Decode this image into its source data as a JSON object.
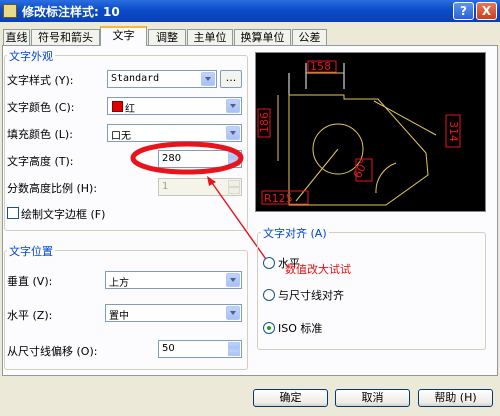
{
  "window": {
    "title": "修改标注样式: 10",
    "help": "?",
    "close": "X"
  },
  "tabs": [
    "直线",
    "符号和箭头",
    "文字",
    "调整",
    "主单位",
    "换算单位",
    "公差"
  ],
  "text_appearance": {
    "group": "文字外观",
    "style_label": "文字样式 (Y):",
    "style_value": "Standard",
    "style_button": "...",
    "color_label": "文字颜色 (C):",
    "color_value": "红",
    "color_swatch": "#e00000",
    "fill_label": "填充颜色 (L):",
    "fill_value": "口无",
    "height_label": "文字高度 (T):",
    "height_value": "280",
    "fraction_label": "分数高度比例 (H):",
    "fraction_value": "1",
    "frame_label": "绘制文字边框 (F)"
  },
  "text_position": {
    "group": "文字位置",
    "vertical_label": "垂直 (V):",
    "vertical_value": "上方",
    "horizontal_label": "水平 (Z):",
    "horizontal_value": "置中",
    "offset_label": "从尺寸线偏移 (O):",
    "offset_value": "50"
  },
  "preview": {
    "dim_top": "158",
    "dim_left": "186",
    "dim_right": "314",
    "dim_angle": "60°",
    "dim_radius": "R125"
  },
  "alignment": {
    "group": "文字对齐 (A)",
    "options": [
      "水平",
      "与尺寸线对齐",
      "ISO 标准"
    ],
    "selected": "ISO 标准"
  },
  "annotation": "数值改大试试",
  "buttons": {
    "ok": "确定",
    "cancel": "取消",
    "help": "帮助 (H)"
  }
}
